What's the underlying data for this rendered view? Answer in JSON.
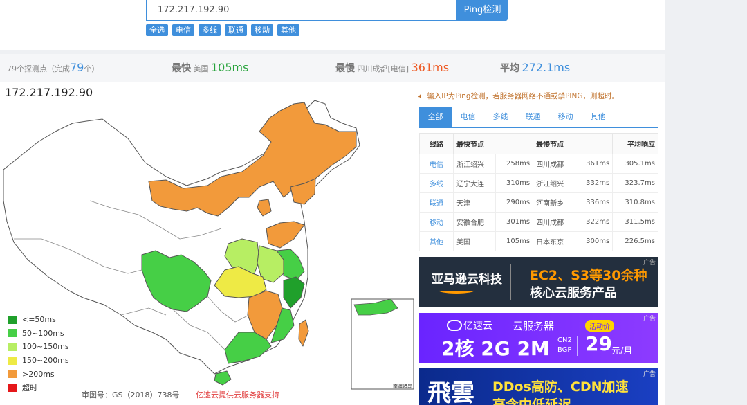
{
  "search": {
    "value": "172.217.192.90",
    "button": "Ping检测"
  },
  "filters": [
    "全选",
    "电信",
    "多线",
    "联通",
    "移动",
    "其他"
  ],
  "stats": {
    "probes_prefix": "79个探测点（完成",
    "probes_done": "79",
    "probes_suffix": "个）",
    "fastest_label": "最快",
    "fastest_loc": "美国",
    "fastest_ms": "105ms",
    "slowest_label": "最慢",
    "slowest_loc": "四川成都[电信]",
    "slowest_ms": "361ms",
    "avg_label": "平均",
    "avg_ms": "272.1ms"
  },
  "map": {
    "ip": "172.217.192.90",
    "inset_label": "南海诸岛"
  },
  "legend": [
    {
      "label": "<=50ms",
      "color": "#20a02b"
    },
    {
      "label": "50~100ms",
      "color": "#46cf46"
    },
    {
      "label": "100~150ms",
      "color": "#b7ee63"
    },
    {
      "label": "150~200ms",
      "color": "#eeea45"
    },
    {
      "label": ">200ms",
      "color": "#f29a3b"
    },
    {
      "label": "超时",
      "color": "#e5171a"
    }
  ],
  "footnote": {
    "map_no": "审图号：GS（2018）738号",
    "provider": "亿速云提供云服务器支持"
  },
  "notice": "输入IP为Ping检测，若服务器网络不通或禁PING，则超时。",
  "tabs": [
    "全部",
    "电信",
    "多线",
    "联通",
    "移动",
    "其他"
  ],
  "table": {
    "headers": [
      "线路",
      "最快节点",
      "最慢节点",
      "平均响应"
    ],
    "rows": [
      {
        "line": "电信",
        "fast": "浙江绍兴",
        "fast_ms": "258ms",
        "slow": "四川成都",
        "slow_ms": "361ms",
        "avg": "305.1ms"
      },
      {
        "line": "多线",
        "fast": "辽宁大连",
        "fast_ms": "310ms",
        "slow": "浙江绍兴",
        "slow_ms": "332ms",
        "avg": "323.7ms"
      },
      {
        "line": "联通",
        "fast": "天津",
        "fast_ms": "290ms",
        "slow": "河南新乡",
        "slow_ms": "336ms",
        "avg": "310.8ms"
      },
      {
        "line": "移动",
        "fast": "安徽合肥",
        "fast_ms": "301ms",
        "slow": "四川成都",
        "slow_ms": "322ms",
        "avg": "311.5ms"
      },
      {
        "line": "其他",
        "fast": "美国",
        "fast_ms": "105ms",
        "slow": "日本东京",
        "slow_ms": "300ms",
        "avg": "226.5ms"
      }
    ]
  },
  "ads": {
    "tag": "广告",
    "ad1_brand": "亚马逊云科技",
    "ad1_line1": "EC2、S3等30余种",
    "ad1_line2": "核心云服务产品",
    "ad2_brand": "亿速云",
    "ad2_title": "云服务器",
    "ad2_badge": "活动价",
    "ad2_specs": "2核 2G 2M",
    "ad2_net1": "CN2",
    "ad2_net2": "BGP",
    "ad2_price": "29",
    "ad2_unit": "元/月",
    "ad3_brand": "飛雲",
    "ad3_line1": "DDos高防、CDN加速",
    "ad3_line2": "高含中低延迟"
  }
}
